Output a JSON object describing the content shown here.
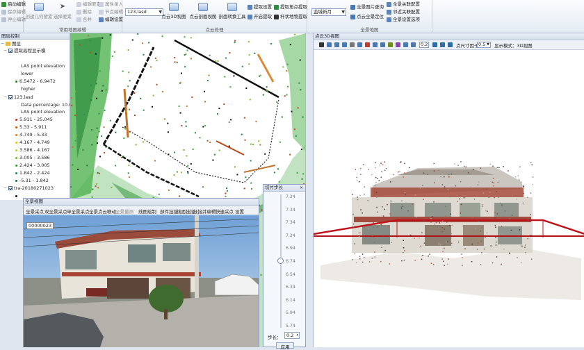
{
  "ribbon": {
    "group1": {
      "items": [
        "启动编辑",
        "保存编辑",
        "停止编辑"
      ]
    },
    "group2": {
      "caption": "常用地图编辑",
      "items": [
        "创建几何要素",
        "选择要素",
        "编辑要素",
        "删除",
        "合并",
        "属性录入",
        "节点编辑",
        "编辑设置"
      ]
    },
    "group3": {
      "caption": "点云处理",
      "combo": "123.lasd",
      "buttons": [
        "点云3D视图",
        "点云剖面视图",
        "剖面转换工具",
        "提取设置",
        "开启提取",
        "提取角点提取",
        "杆状地物提取"
      ]
    },
    "group4": {
      "caption": "全景地图",
      "combo": "监城新月",
      "items": [
        "全景图片查询",
        "点云全景定位"
      ]
    },
    "group5": {
      "items": [
        "全景关联配置",
        "邻近关联配置",
        "全景设置选项"
      ]
    }
  },
  "layer_panel": {
    "title": "图层控制",
    "root": "图层",
    "layers": [
      {
        "name": "提取高程显示模",
        "checked": true
      },
      {
        "text": "LAS point elevation"
      },
      {
        "text": "lower"
      },
      {
        "text": "6.5472 - 6.9472",
        "color": "#2f7d2f"
      },
      {
        "text": "higher"
      },
      {
        "name": "123.lasd",
        "checked": true
      },
      {
        "text": "Data percentage: 10.0"
      },
      {
        "text": "LAS point elevation"
      },
      {
        "text": "5.911 - 25.045",
        "color": "#c0392b"
      },
      {
        "text": "5.33 - 5.911",
        "color": "#d35400"
      },
      {
        "text": "4.749 - 5.33",
        "color": "#e67e22"
      },
      {
        "text": "4.167 - 4.749",
        "color": "#f1c40f"
      },
      {
        "text": "3.586 - 4.167",
        "color": "#b7d433"
      },
      {
        "text": "3.005 - 3.586",
        "color": "#7dbb2f"
      },
      {
        "text": "2.424 - 3.005",
        "color": "#3fa33a"
      },
      {
        "text": "1.842 - 2.424",
        "color": "#2e8b57"
      },
      {
        "text": "-5.31 - 1.842",
        "color": "#1f6f3f"
      },
      {
        "name": "tra-20180271023",
        "checked": true
      }
    ]
  },
  "pc3d": {
    "title": "点云3D视图",
    "zoom": "0.2",
    "point_size_label": "点尺寸因子",
    "point_size": "0.5",
    "display_mode": "显示模式：3D视图"
  },
  "pano": {
    "title": "全景视图",
    "menu": [
      "全景采点",
      "双全景采点",
      "单全景采点",
      "全景点云联动",
      "全景量测",
      "线图绘制",
      "部件挂接",
      "线面挂接",
      "挂接并编辑",
      "快速采点",
      "设置"
    ],
    "photo_id": "00000023"
  },
  "step_panel": {
    "title": "切片步长",
    "ticks": [
      "7.24",
      "7.34",
      "7.34",
      "7.24",
      "6.94",
      "6.74",
      "6.54",
      "6.34",
      "6.14",
      "5.94",
      "5.74"
    ],
    "step_label": "步长：",
    "step_value": "0.2",
    "apply_label": "应用"
  }
}
